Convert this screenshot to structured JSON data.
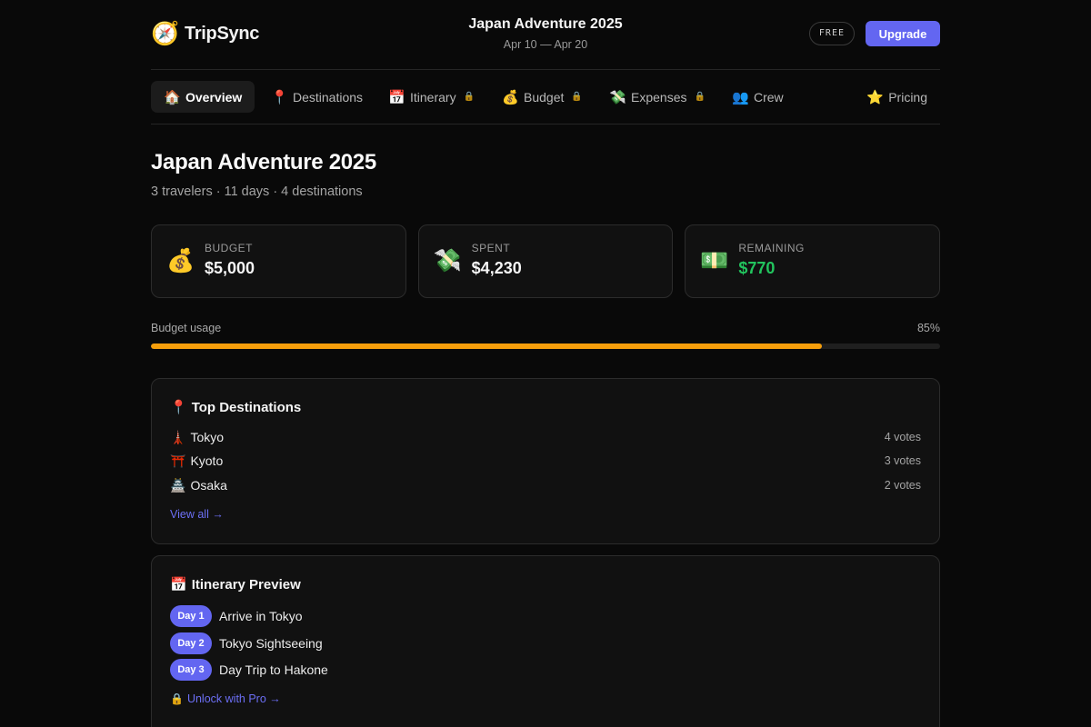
{
  "brand": {
    "icon": "🧭",
    "name": "TripSync"
  },
  "trip": {
    "title": "Japan Adventure 2025",
    "dates": "Apr 10 — Apr 20"
  },
  "plan_badge": "FREE",
  "upgrade_label": "Upgrade",
  "nav": {
    "items": [
      {
        "icon": "🏠",
        "label": "Overview",
        "active": true,
        "locked": false
      },
      {
        "icon": "📍",
        "label": "Destinations",
        "active": false,
        "locked": false
      },
      {
        "icon": "📅",
        "label": "Itinerary",
        "active": false,
        "locked": true
      },
      {
        "icon": "💰",
        "label": "Budget",
        "active": false,
        "locked": true
      },
      {
        "icon": "💸",
        "label": "Expenses",
        "active": false,
        "locked": true
      },
      {
        "icon": "👥",
        "label": "Crew",
        "active": false,
        "locked": false
      },
      {
        "icon": "⭐",
        "label": "Pricing",
        "active": false,
        "locked": false
      }
    ],
    "lock_icon": "🔒"
  },
  "page": {
    "title": "Japan Adventure 2025",
    "subtitle": "3 travelers · 11 days · 4 destinations"
  },
  "stats": [
    {
      "icon": "💰",
      "label": "BUDGET",
      "value": "$5,000",
      "color": "#f5f5f5"
    },
    {
      "icon": "💸",
      "label": "SPENT",
      "value": "$4,230",
      "color": "#f5f5f5"
    },
    {
      "icon": "💵",
      "label": "REMAINING",
      "value": "$770",
      "color": "#22c55e"
    }
  ],
  "usage": {
    "label": "Budget usage",
    "percent_label": "85%",
    "percent": 85,
    "color": "#f59e0b"
  },
  "destinations_panel": {
    "icon": "📍",
    "title": "Top Destinations",
    "items": [
      {
        "icon": "🗼",
        "name": "Tokyo",
        "votes": "4 votes"
      },
      {
        "icon": "⛩️",
        "name": "Kyoto",
        "votes": "3 votes"
      },
      {
        "icon": "🏯",
        "name": "Osaka",
        "votes": "2 votes"
      }
    ],
    "link": "View all →"
  },
  "itinerary_panel": {
    "icon": "📅",
    "title": "Itinerary Preview",
    "items": [
      {
        "day": "Day 1",
        "text": "Arrive in Tokyo"
      },
      {
        "day": "Day 2",
        "text": "Tokyo Sightseeing"
      },
      {
        "day": "Day 3",
        "text": "Day Trip to Hakone"
      }
    ],
    "lock_icon": "🔒",
    "link": "Unlock with Pro →"
  },
  "colors": {
    "accent": "#6366f1",
    "background": "#090909",
    "card": "#111111",
    "positive": "#22c55e",
    "warning": "#f59e0b"
  }
}
